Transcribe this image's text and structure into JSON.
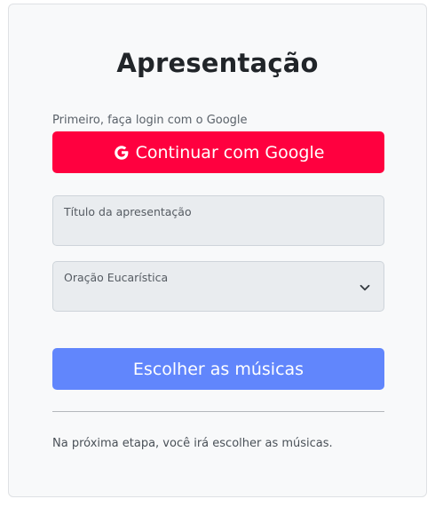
{
  "page": {
    "title": "Apresentação",
    "login_hint": "Primeiro, faça login com o Google",
    "google_button_label": "Continuar com Google",
    "title_field_label": "Título da apresentação",
    "title_field_value": "",
    "prayer_select_label": "Oração Eucarística",
    "prayer_select_value": "",
    "choose_songs_button_label": "Escolher as músicas",
    "footer_note": "Na próxima etapa, você irá escolher as músicas."
  },
  "icons": {
    "google": "google-g-icon",
    "select": "chevron-down-icon"
  },
  "colors": {
    "google_button": "#ff003f",
    "primary_button": "#6186fc",
    "card_background": "#f8f9fa",
    "field_background": "#e9ecef"
  }
}
